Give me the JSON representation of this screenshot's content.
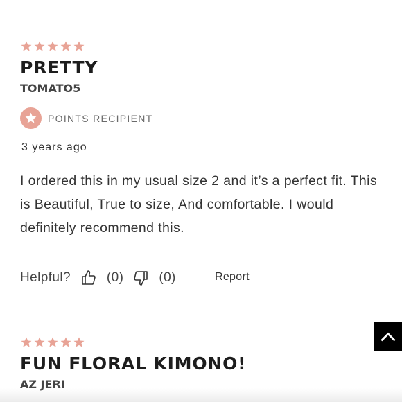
{
  "reviews": [
    {
      "rating": 5,
      "title": "PRETTY",
      "author": "TOMATO5",
      "badge": "POINTS RECIPIENT",
      "date": "3 years ago",
      "body": "I ordered this in my usual size 2 and it’s a perfect fit. This is Beautiful, True to size, And comfortable. I would definitely recommend this.",
      "helpful_label": "Helpful?",
      "upvotes": "(0)",
      "downvotes": "(0)",
      "report_label": "Report"
    },
    {
      "rating": 5,
      "title": "FUN FLORAL KIMONO!",
      "author": "AZ JERI"
    }
  ],
  "icons": {
    "star": "star-icon",
    "badge": "star-badge-icon",
    "thumbs_up": "thumbs-up-icon",
    "thumbs_down": "thumbs-down-icon",
    "back_to_top": "chevron-up-icon"
  },
  "colors": {
    "star": "#e8a396",
    "badge": "#e8a396",
    "back_to_top_bg": "#000000"
  }
}
